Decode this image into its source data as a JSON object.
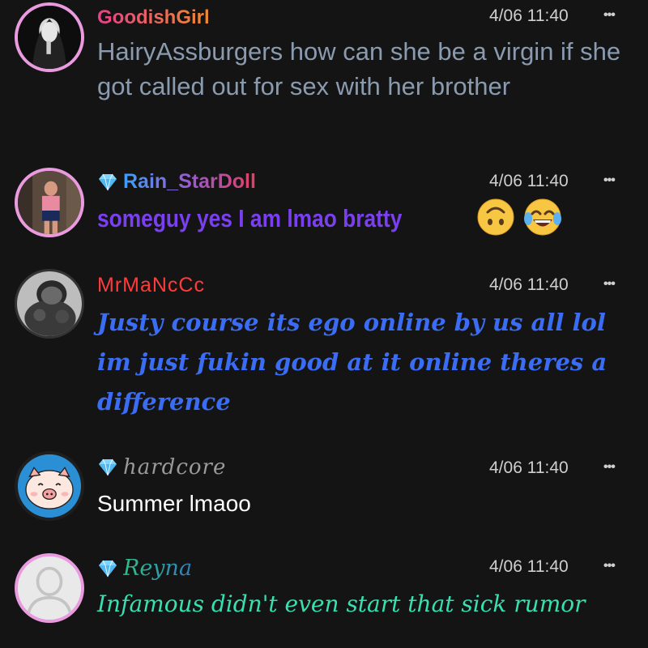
{
  "messages": [
    {
      "username": "GoodishGirl",
      "timestamp": "4/06 11:40",
      "menu": "•••",
      "text": "HairyAssburgers how can she be a virgin if she got called out for sex with her brother",
      "has_badge": false
    },
    {
      "username": "Rain_StarDoll",
      "timestamp": "4/06 11:40",
      "menu": "•••",
      "text": "someguy yes I am lmao bratty",
      "emojis": [
        "upside-down-face",
        "tears-of-joy"
      ],
      "has_badge": true
    },
    {
      "username": "MrMaNcCc",
      "timestamp": "4/06 11:40",
      "menu": "•••",
      "text": "Justy course its ego online by us all lol im just fukin good at it online theres a difference",
      "has_badge": false
    },
    {
      "username": "hardcore",
      "timestamp": "4/06 11:40",
      "menu": "•••",
      "text": "Summer lmaoo",
      "has_badge": true
    },
    {
      "username": "Reyna",
      "timestamp": "4/06 11:40",
      "menu": "•••",
      "text": "Infamous didn't even start that sick rumor",
      "has_badge": true
    }
  ],
  "colors": {
    "background": "#141414",
    "timestamp": "#cfcfcf",
    "goodishgirl_name": "#e8408a",
    "goodishgirl_text": "#8a9bb0",
    "rain_name_start": "#3aa0ff",
    "rain_name_end": "#e04060",
    "rain_text": "#7a3ff0",
    "mrmanccc_name": "#ff3b3b",
    "mrmanccc_text": "#3a6cf4",
    "hardcore_name": "#9a9a9a",
    "hardcore_text": "#ffffff",
    "reyna_name": "#2fbf8a",
    "reyna_text": "#38e0b0",
    "gem": "#7fd4ff"
  }
}
